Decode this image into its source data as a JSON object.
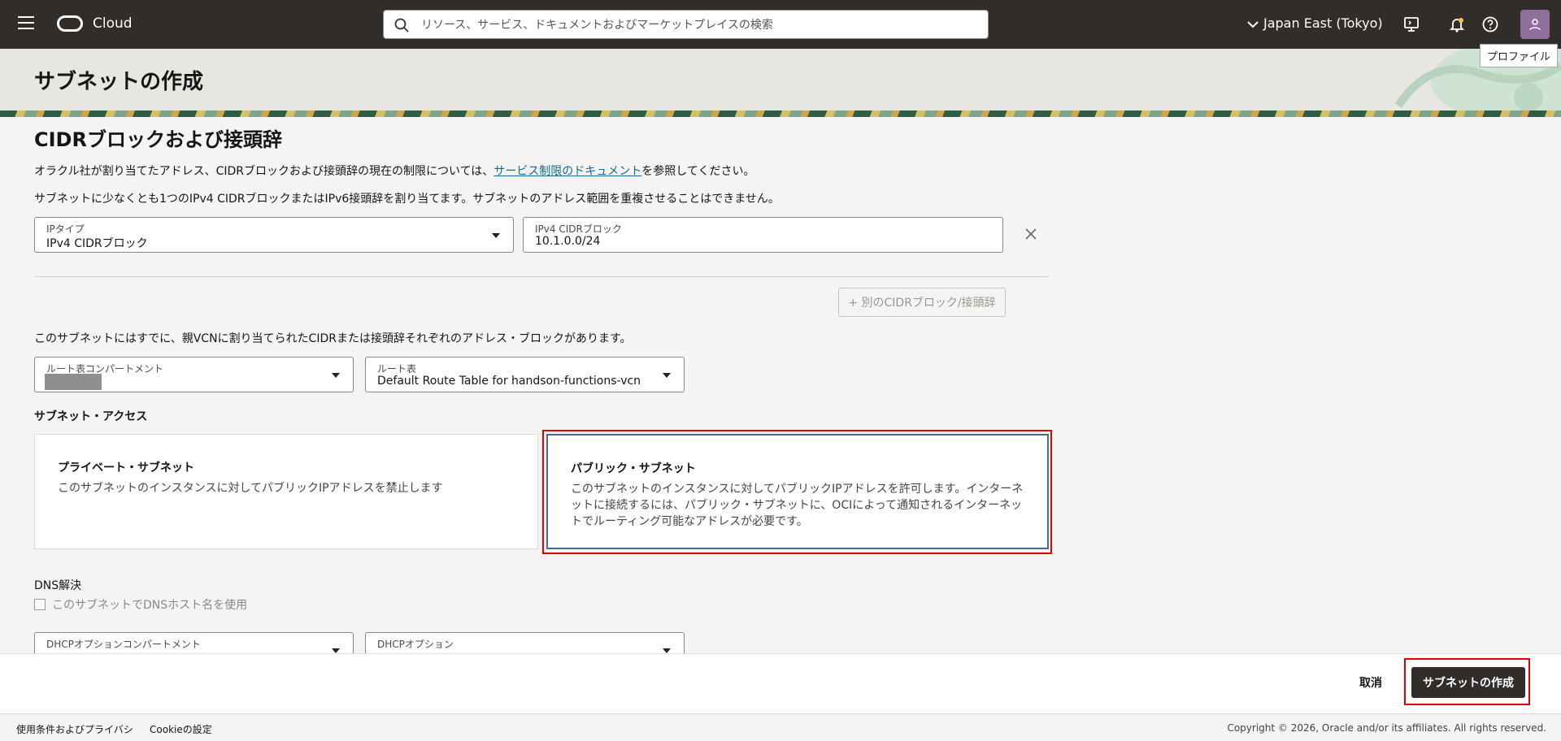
{
  "topbar": {
    "brand": "Cloud",
    "search_placeholder": "リソース、サービス、ドキュメントおよびマーケットプレイスの検索",
    "region": "Japan East (Tokyo)",
    "tooltip": "プロファイル"
  },
  "page": {
    "title": "サブネットの作成"
  },
  "cidr": {
    "heading": "CIDRブロックおよび接頭辞",
    "note_before": "オラクル社が割り当てたアドレス、CIDRブロックおよび接頭辞の現在の制限については、",
    "note_link": "サービス制限のドキュメント",
    "note_after": "を参照してください。",
    "desc": "サブネットに少なくとも1つのIPv4 CIDRブロックまたはIPv6接頭辞を割り当てます。サブネットのアドレス範囲を重複させることはできません。",
    "ip_type_label": "IPタイプ",
    "ip_type_value": "IPv4 CIDRブロック",
    "block_label": "IPv4 CIDRブロック",
    "block_value": "10.1.0.0/24",
    "add_button": "+ 別のCIDRブロック/接頭辞",
    "existing_note": "このサブネットにはすでに、親VCNに割り当てられたCIDRまたは接頭辞それぞれのアドレス・ブロックがあります。"
  },
  "route": {
    "compartment_label": "ルート表コンパートメント",
    "table_label": "ルート表",
    "table_value": "Default Route Table for handson-functions-vcn"
  },
  "access": {
    "label": "サブネット・アクセス",
    "private_title": "プライベート・サブネット",
    "private_desc": "このサブネットのインスタンスに対してパブリックIPアドレスを禁止します",
    "public_title": "パブリック・サブネット",
    "public_desc": "このサブネットのインスタンスに対してパブリックIPアドレスを許可します。インターネットに接続するには、パブリック・サブネットに、OCIによって通知されるインターネットでルーティング可能なアドレスが必要です。",
    "selected": "public"
  },
  "dns": {
    "label": "DNS解決",
    "checkbox_label": "このサブネットでDNSホスト名を使用",
    "checked": false
  },
  "dhcp": {
    "compartment_label": "DHCPオプションコンパートメント",
    "options_label": "DHCPオプション"
  },
  "actions": {
    "cancel": "取消",
    "create": "サブネットの作成"
  },
  "footer": {
    "terms": "使用条件およびプライバシ",
    "cookies": "Cookieの設定",
    "copyright": "Copyright © 2026, Oracle and/or its affiliates. All rights reserved."
  },
  "colors": {
    "topbar": "#312d2a",
    "link": "#146c94",
    "highlight": "#e00000",
    "selected_border": "#406f8c"
  }
}
